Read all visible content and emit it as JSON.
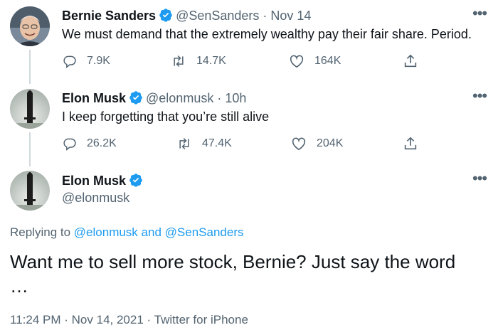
{
  "tweet1": {
    "name": "Bernie Sanders",
    "handle": "@SenSanders",
    "separator": "·",
    "date": "Nov 14",
    "text": "We must demand that the extremely wealthy pay their fair share. Period.",
    "replies": "7.9K",
    "retweets": "14.7K",
    "likes": "164K",
    "more_icon": "more-dots-icon"
  },
  "tweet2": {
    "name": "Elon Musk",
    "handle": "@elonmusk",
    "separator": "·",
    "date": "10h",
    "text": "I keep forgetting that you’re still alive",
    "replies": "26.2K",
    "retweets": "47.4K",
    "likes": "204K"
  },
  "tweet3": {
    "name": "Elon Musk",
    "handle": "@elonmusk",
    "replying_prefix": "Replying to",
    "replying_user1": "@elonmusk",
    "replying_and": "and",
    "replying_user2": "@SenSanders",
    "text_line1": "Want me to sell more stock, Bernie? Just say the word",
    "text_line2": "…",
    "time": "11:24 PM",
    "sep1": "·",
    "date": "Nov 14, 2021",
    "sep2": "·",
    "source": "Twitter for iPhone"
  },
  "colors": {
    "verified": "#1d9bf0",
    "secondary_text": "#536471",
    "link": "#1d9bf0"
  }
}
